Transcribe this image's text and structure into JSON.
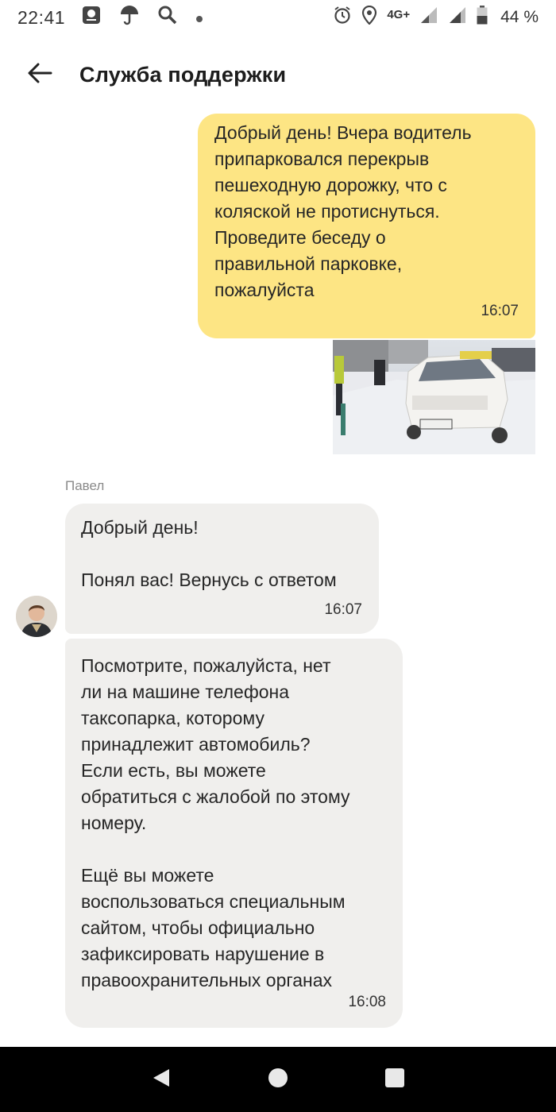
{
  "status_bar": {
    "time": "22:41",
    "network": "4G+",
    "battery": "44 %",
    "left_icons": [
      "app-notification-icon",
      "umbrella-icon",
      "search-icon",
      "dot-icon"
    ],
    "right_icons": [
      "alarm-icon",
      "location-icon",
      "signal-icon",
      "signal-icon",
      "battery-icon"
    ]
  },
  "header": {
    "back_icon": "arrow-left-icon",
    "title": "Служба поддержки"
  },
  "messages": {
    "outgoing": {
      "text": "Добрый день! Вчера водитель\nприпарковался перекрыв\nпешеходную дорожку, что с\nколяской не протиснуться.\nПроведите беседу о\nправильной парковке,\nпожалуйста",
      "time": "16:07"
    },
    "sender_name": "Павел",
    "incoming_1": {
      "text": "Добрый день!\n\nПонял вас! Вернусь с ответом",
      "time": "16:07"
    },
    "incoming_2": {
      "text": "Посмотрите, пожалуйста, нет\nли на машине телефона\nтаксопарка, которому\nпринадлежит автомобиль?\nЕсли есть, вы можете\nобратиться с жалобой по этому\nномеру.\n\nЕщё вы можете\nвоспользоваться специальным\nсайтом, чтобы официально\nзафиксировать нарушение в\nправоохранительных органах",
      "time": "16:08"
    }
  },
  "nav_bar": {
    "buttons": [
      "back-triangle-icon",
      "home-circle-icon",
      "recents-square-icon"
    ]
  },
  "colors": {
    "outgoing_bubble": "#fde584",
    "incoming_bubble": "#f0efed",
    "nav_bar": "#000000"
  }
}
